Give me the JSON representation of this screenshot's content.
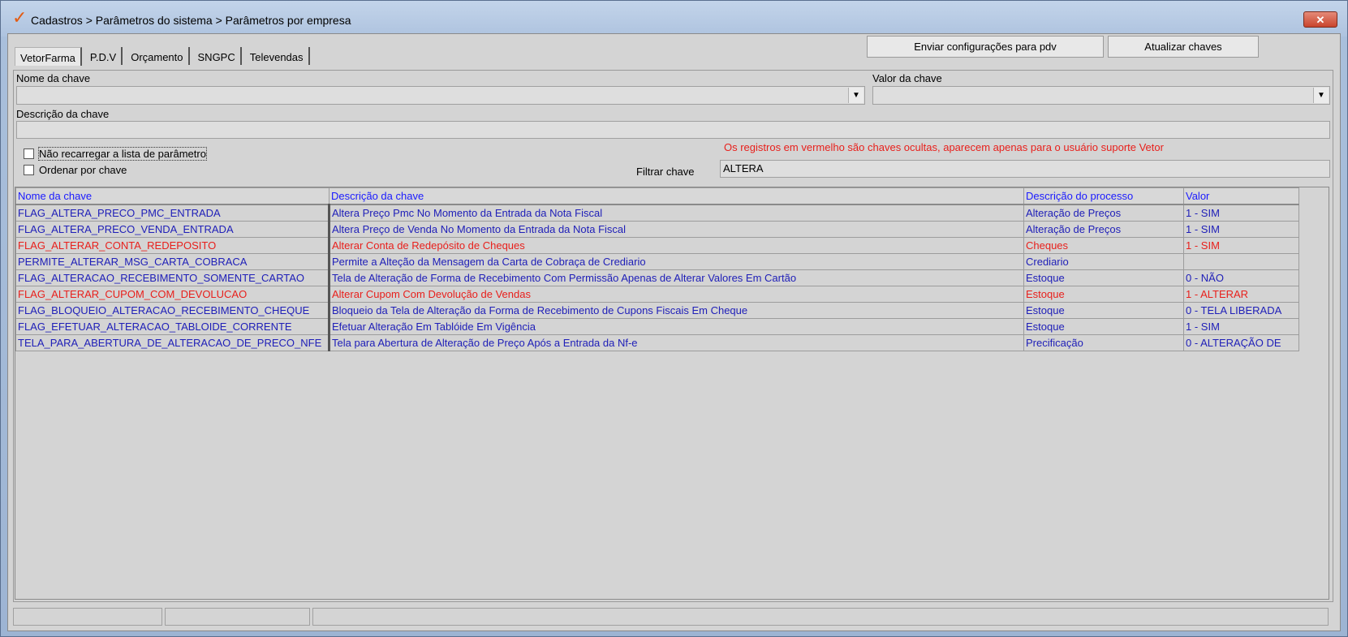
{
  "window": {
    "title": "Cadastros > Parâmetros do sistema > Parâmetros por empresa",
    "close_label": "✕"
  },
  "tabs": [
    "VetorFarma",
    "P.D.V",
    "Orçamento",
    "SNGPC",
    "Televendas"
  ],
  "buttons": {
    "send_config": "Enviar configurações para  pdv",
    "refresh_keys": "Atualizar chaves"
  },
  "form": {
    "key_name_label": "Nome da chave",
    "key_value_label": "Valor da chave",
    "key_desc_label": "Descrição da chave",
    "no_reload_label": "Não recarregar a lista de parâmetro",
    "order_by_key_label": "Ordenar por chave",
    "notice": "Os registros em vermelho são chaves ocultas, aparecem apenas para o usuário suporte Vetor",
    "filter_label": "Filtrar chave",
    "filter_value": "ALTERA"
  },
  "table": {
    "headers": [
      "Nome da chave",
      "Descrição  da chave",
      "Descrição do processo",
      "Valor"
    ],
    "rows": [
      {
        "hidden": false,
        "cells": [
          "FLAG_ALTERA_PRECO_PMC_ENTRADA",
          "Altera Preço Pmc No Momento da Entrada da Nota Fiscal",
          "Alteração de Preços",
          "1 - SIM"
        ]
      },
      {
        "hidden": false,
        "cells": [
          "FLAG_ALTERA_PRECO_VENDA_ENTRADA",
          "Altera Preço de Venda No Momento da Entrada da Nota Fiscal",
          "Alteração de Preços",
          "1 - SIM"
        ]
      },
      {
        "hidden": true,
        "cells": [
          "FLAG_ALTERAR_CONTA_REDEPOSITO",
          "Alterar Conta de Redepósito de Cheques",
          "Cheques",
          "1 - SIM"
        ]
      },
      {
        "hidden": false,
        "cells": [
          "PERMITE_ALTERAR_MSG_CARTA_COBRACA",
          "Permite a Alteção da Mensagem da Carta de Cobraça de Crediario",
          "Crediario",
          ""
        ]
      },
      {
        "hidden": false,
        "cells": [
          "FLAG_ALTERACAO_RECEBIMENTO_SOMENTE_CARTAO",
          "Tela de Alteração de Forma de Recebimento Com Permissão Apenas de Alterar Valores Em Cartão",
          "Estoque",
          "0 - NÃO"
        ]
      },
      {
        "hidden": true,
        "cells": [
          "FLAG_ALTERAR_CUPOM_COM_DEVOLUCAO",
          "Alterar Cupom Com Devolução de Vendas",
          "Estoque",
          "1 - ALTERAR"
        ]
      },
      {
        "hidden": false,
        "cells": [
          "FLAG_BLOQUEIO_ALTERACAO_RECEBIMENTO_CHEQUE",
          "Bloqueio da Tela de Alteração da Forma de Recebimento de Cupons Fiscais Em Cheque",
          "Estoque",
          "0 - TELA LIBERADA"
        ]
      },
      {
        "hidden": false,
        "cells": [
          "FLAG_EFETUAR_ALTERACAO_TABLOIDE_CORRENTE",
          "Efetuar Alteração Em Tablóide Em Vigência",
          "Estoque",
          "1 - SIM"
        ]
      },
      {
        "hidden": false,
        "cells": [
          "TELA_PARA_ABERTURA_DE_ALTERACAO_DE_PRECO_NFE",
          "Tela para Abertura de Alteração de Preço Após a Entrada da Nf-e",
          "Precificação",
          "0 - ALTERAÇÃO DE"
        ]
      }
    ]
  },
  "colors": {
    "normal_row": "#2020b8",
    "hidden_row": "#e8201c",
    "header_text": "#1a1aff"
  }
}
